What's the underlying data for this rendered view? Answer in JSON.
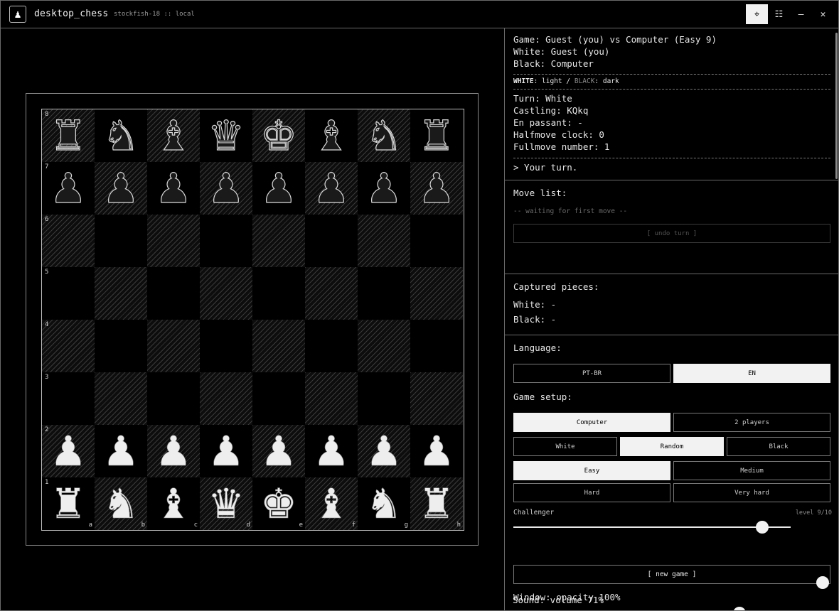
{
  "titlebar": {
    "app_name": "desktop_chess",
    "subtitle": "stockfish-18 :: local",
    "buttons": {
      "drag": "⌖",
      "menu": "☷",
      "minimize": "–",
      "close": "✕"
    }
  },
  "board": {
    "rank_labels": [
      "8",
      "7",
      "6",
      "5",
      "4",
      "3",
      "2",
      "1"
    ],
    "file_labels": [
      "a",
      "b",
      "c",
      "d",
      "e",
      "f",
      "g",
      "h"
    ],
    "position": [
      [
        "bR",
        "bN",
        "bB",
        "bQ",
        "bK",
        "bB",
        "bN",
        "bR"
      ],
      [
        "bP",
        "bP",
        "bP",
        "bP",
        "bP",
        "bP",
        "bP",
        "bP"
      ],
      [
        "",
        "",
        "",
        "",
        "",
        "",
        "",
        ""
      ],
      [
        "",
        "",
        "",
        "",
        "",
        "",
        "",
        ""
      ],
      [
        "",
        "",
        "",
        "",
        "",
        "",
        "",
        ""
      ],
      [
        "",
        "",
        "",
        "",
        "",
        "",
        "",
        ""
      ],
      [
        "wP",
        "wP",
        "wP",
        "wP",
        "wP",
        "wP",
        "wP",
        "wP"
      ],
      [
        "wR",
        "wN",
        "wB",
        "wQ",
        "wK",
        "wB",
        "wN",
        "wR"
      ]
    ]
  },
  "info": {
    "game": "Game: Guest (you) vs Computer (Easy 9)",
    "white": "White: Guest (you)",
    "black": "Black: Computer",
    "legend_white": "WHITE",
    "legend_white_val": ": light / ",
    "legend_black": "BLACK",
    "legend_black_val": ": dark",
    "turn": "Turn: White",
    "castling": "Castling: KQkq",
    "en_passant": "En passant: -",
    "halfmove": "Halfmove clock: 0",
    "fullmove": "Fullmove number: 1",
    "prompt": "> Your turn."
  },
  "moves": {
    "title": "Move list:",
    "waiting": "-- waiting for first move --",
    "undo_label": "[ undo turn ]"
  },
  "captured": {
    "title": "Captured pieces:",
    "white": "White: -",
    "black": "Black: -"
  },
  "settings": {
    "language_title": "Language:",
    "languages": [
      "PT-BR",
      "EN"
    ],
    "language_selected": "EN",
    "setup_title": "Game setup:",
    "opponents": [
      "Computer",
      "2 players"
    ],
    "opponent_selected": "Computer",
    "sides": [
      "White",
      "Random",
      "Black"
    ],
    "side_selected": "Random",
    "difficulties": [
      "Easy",
      "Medium",
      "Hard",
      "Very hard"
    ],
    "difficulty_selected": "Easy",
    "challenger_label": "Challenger",
    "level_text": "level 9/10",
    "level_value": 9,
    "level_max": 10,
    "new_game_label": "[ new game ]",
    "opacity_label": "Window: opacity 100%",
    "opacity_value": 100,
    "sound_label": "Sound: volume 71%",
    "sound_value": 71
  },
  "colors": {
    "background": "#000000",
    "foreground": "#e8e8e8",
    "selected": "#f2f2f2",
    "border": "#6a6a6a"
  }
}
